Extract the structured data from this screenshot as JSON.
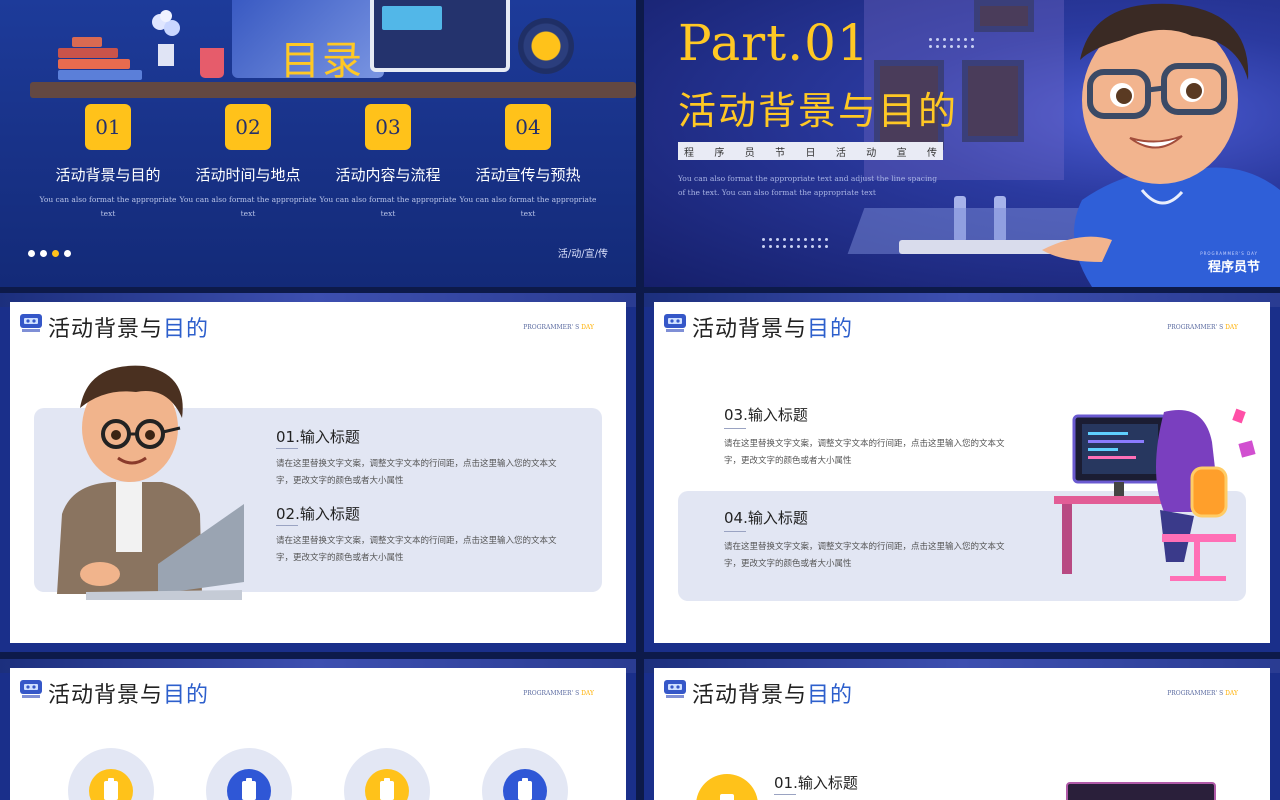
{
  "agenda": {
    "title": "目录",
    "items": [
      {
        "num": "01",
        "label": "活动背景与目的",
        "desc": "You can also format the appropriate text"
      },
      {
        "num": "02",
        "label": "活动时间与地点",
        "desc": "You can also format the appropriate text"
      },
      {
        "num": "03",
        "label": "活动内容与流程",
        "desc": "You can also format the appropriate text"
      },
      {
        "num": "04",
        "label": "活动宣传与预热",
        "desc": "You can also format the appropriate text"
      }
    ],
    "footer": "活/动/宣/传",
    "colors": {
      "accent": "#ffc21a",
      "background": "#1d3b9a"
    }
  },
  "part": {
    "title": "Part.01",
    "subtitle": "活动背景与目的",
    "tags": [
      "程",
      "序",
      "员",
      "节",
      "日",
      "活",
      "动",
      "宣",
      "传"
    ],
    "desc": "You can also format the appropriate text and adjust the line spacing of the text. You can also format the appropriate text",
    "brand": "程序员节",
    "brand_small": "PROGRAMMER'S DAY"
  },
  "slide_header": {
    "title_main": "活动背景与",
    "title_highlight": "目的",
    "tag_main": "PROGRAMMER' S",
    "tag_highlight": "DAY"
  },
  "slide3": {
    "items": [
      {
        "title": "01.输入标题",
        "text": "请在这里替换文字文案，调整文字文本的行间距，点击这里输入您的文本文字，更改文字的颜色或者大小属性"
      },
      {
        "title": "02.输入标题",
        "text": "请在这里替换文字文案，调整文字文本的行间距，点击这里输入您的文本文字，更改文字的颜色或者大小属性"
      }
    ]
  },
  "slide4": {
    "items": [
      {
        "title": "03.输入标题",
        "text": "请在这里替换文字文案，调整文字文本的行间距，点击这里输入您的文本文字，更改文字的颜色或者大小属性"
      },
      {
        "title": "04.输入标题",
        "text": "请在这里替换文字文案，调整文字文本的行间距，点击这里输入您的文本文字，更改文字的颜色或者大小属性"
      }
    ]
  },
  "slide6": {
    "items": [
      {
        "title": "01.输入标题"
      }
    ]
  }
}
